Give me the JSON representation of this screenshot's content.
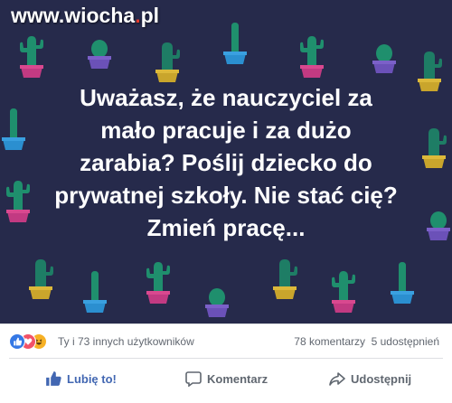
{
  "image": {
    "watermark": {
      "prefix": "www.",
      "name": "wiocha",
      "dot": ".",
      "tld": "pl"
    },
    "headline_lines": [
      "Uważasz, że nauczyciel za",
      "mało pracuje i za dużo",
      "zarabia? Poślij dziecko do",
      "prywatnej szkoły. Nie stać cię?",
      "Zmień pracę..."
    ],
    "background_color": "#262a4b",
    "pattern_icon": "cactus-in-pot"
  },
  "reactions": {
    "icons": [
      "like-reaction-icon",
      "love-reaction-icon",
      "haha-reaction-icon"
    ],
    "text": "Ty i 73 innych użytkowników",
    "comments": "78 komentarzy",
    "shares": "5 udostępnień"
  },
  "actions": {
    "like_label": "Lubię to!",
    "comment_label": "Komentarz",
    "share_label": "Udostępnij"
  },
  "colors": {
    "like_blue": "#4267b2",
    "text_gray": "#616770",
    "divider": "#dddfe2"
  }
}
